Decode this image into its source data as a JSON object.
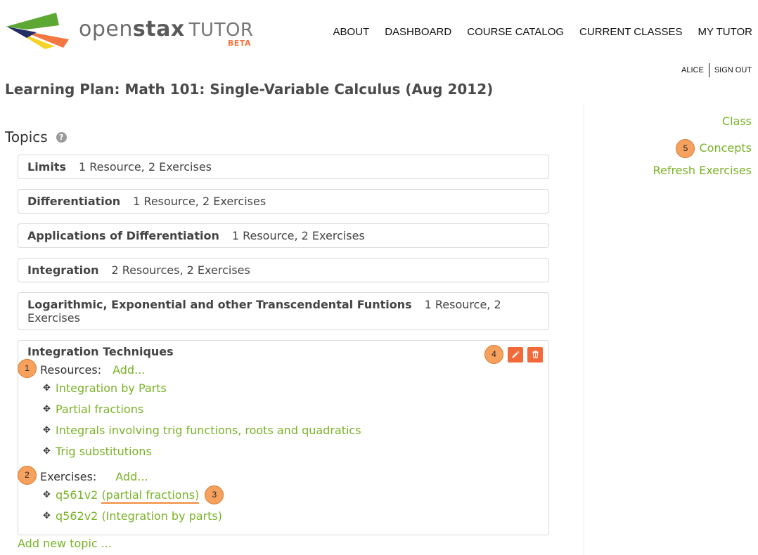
{
  "brand": {
    "name_light": "open",
    "name_bold": "stax",
    "product": "TUTOR",
    "tag": "BETA",
    "colors": {
      "green": "#5da832",
      "orange": "#f47641",
      "yellow": "#f5d328",
      "navy": "#232e66"
    }
  },
  "topnav": [
    "ABOUT",
    "DASHBOARD",
    "COURSE CATALOG",
    "CURRENT CLASSES",
    "MY TUTOR"
  ],
  "user": {
    "name": "ALICE",
    "signout": "SIGN OUT"
  },
  "page_title": "Learning Plan: Math 101: Single-Variable Calculus (Aug 2012)",
  "sidebar": {
    "links": [
      "Class",
      "Concepts",
      "Refresh Exercises"
    ],
    "badge": "5"
  },
  "topics_heading": "Topics",
  "help_glyph": "?",
  "topics": [
    {
      "name": "Limits",
      "count": "1 Resource, 2 Exercises"
    },
    {
      "name": "Differentiation",
      "count": "1 Resource, 2 Exercises"
    },
    {
      "name": "Applications of Differentiation",
      "count": "1 Resource, 2 Exercises"
    },
    {
      "name": "Integration",
      "count": "2 Resources, 2 Exercises"
    },
    {
      "name": "Logarithmic, Exponential and other Transcendental Funtions",
      "count": "1 Resource, 2 Exercises"
    }
  ],
  "open_topic": {
    "name": "Integration Techniques",
    "actions_badge": "4",
    "resources": {
      "label": "Resources:",
      "add": "Add...",
      "badge": "1",
      "items": [
        "Integration by Parts",
        "Partial fractions",
        "Integrals involving trig functions, roots and quadratics",
        "Trig substitutions"
      ]
    },
    "exercises": {
      "label": "Exercises:",
      "add": "Add...",
      "badge": "2",
      "items": [
        {
          "id": "q561v2",
          "topic": "(partial fractions)",
          "badge": "3"
        },
        {
          "id": "q562v2",
          "topic": "(Integration by parts)"
        }
      ]
    }
  },
  "add_topic": "Add new topic ...",
  "accent_colors": {
    "link_green": "#79b226",
    "action_orange": "#f26a3a",
    "badge_orange": "#f7a15e"
  }
}
